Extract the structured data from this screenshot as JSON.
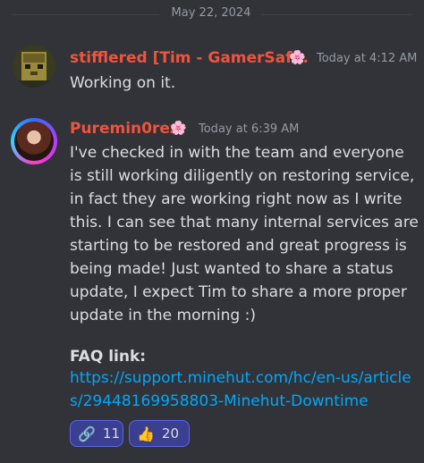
{
  "date_divider": "May 22, 2024",
  "messages": [
    {
      "author": "stifflered [Tim - GamerSaf...",
      "badge_icon": "cherry-blossom",
      "timestamp": "Today at 4:12 AM",
      "text": "Working on it."
    },
    {
      "author": "Puremin0rez",
      "badge_icon": "cherry-blossom",
      "timestamp": "Today at 6:39 AM",
      "text": "I've checked in with the team and everyone is still working diligently on restoring service, in fact they are working right now as I write this. I can see that many internal services are starting to be restored and great progress is being made! Just wanted to share a status update, I expect Tim to share a more proper update in the morning :)",
      "faq_label": "FAQ link:",
      "faq_url": "https://support.minehut.com/hc/en-us/articles/29448169958803-Minehut-Downtime",
      "reactions": [
        {
          "emoji": "🔗",
          "icon": "broken-link",
          "count": "11"
        },
        {
          "emoji": "👍",
          "icon": "thumbs-up",
          "count": "20"
        }
      ]
    }
  ],
  "colors": {
    "background": "#313338",
    "author_name": "#f0533e",
    "link": "#00a8fc",
    "reaction_bg": "#3b3f8f",
    "reaction_border": "#5865f2"
  }
}
